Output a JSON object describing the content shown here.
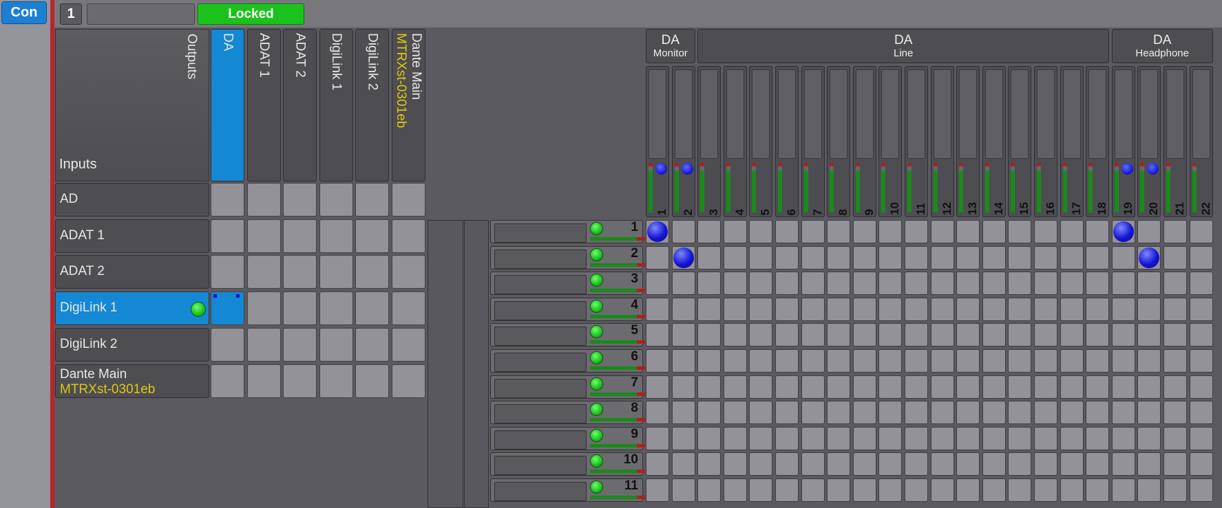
{
  "toolbar": {
    "con_label": "Con"
  },
  "unit": {
    "number": "1",
    "name": "",
    "status": "Locked",
    "status_color": "#1cc21c"
  },
  "accent": "#1588d4",
  "matrix": {
    "outputs_label": "Outputs",
    "inputs_label": "Inputs",
    "outputs": [
      {
        "label": "DA",
        "sub": "",
        "selected": true
      },
      {
        "label": "ADAT 1",
        "sub": "",
        "selected": false
      },
      {
        "label": "ADAT 2",
        "sub": "",
        "selected": false
      },
      {
        "label": "DigiLink 1",
        "sub": "",
        "selected": false
      },
      {
        "label": "DigiLink 2",
        "sub": "",
        "selected": false
      },
      {
        "label": "Dante Main",
        "sub": "MTRXst-0301eb",
        "selected": false
      }
    ],
    "inputs": [
      {
        "label": "AD",
        "sub": "",
        "selected": false
      },
      {
        "label": "ADAT 1",
        "sub": "",
        "selected": false
      },
      {
        "label": "ADAT 2",
        "sub": "",
        "selected": false
      },
      {
        "label": "DigiLink 1",
        "sub": "",
        "selected": true
      },
      {
        "label": "DigiLink 2",
        "sub": "",
        "selected": false
      },
      {
        "label": "Dante Main",
        "sub": "MTRXst-0301eb",
        "selected": false
      }
    ]
  },
  "groups": [
    {
      "title": "DA",
      "subtitle": "Monitor",
      "count": 2
    },
    {
      "title": "DA",
      "subtitle": "Line",
      "count": 16
    },
    {
      "title": "DA",
      "subtitle": "Headphone",
      "count": 4
    }
  ],
  "channels": [
    "1",
    "2",
    "3",
    "4",
    "5",
    "6",
    "7",
    "8",
    "9",
    "10",
    "11",
    "12",
    "13",
    "14",
    "15",
    "16",
    "17",
    "18",
    "19",
    "20",
    "21",
    "22"
  ],
  "channel_dots": [
    1,
    2,
    19,
    20
  ],
  "rows": [
    "1",
    "2",
    "3",
    "4",
    "5",
    "6",
    "7",
    "8",
    "9",
    "10",
    "11"
  ],
  "connections": [
    [
      1,
      1
    ],
    [
      1,
      19
    ],
    [
      2,
      2
    ],
    [
      2,
      20
    ]
  ]
}
